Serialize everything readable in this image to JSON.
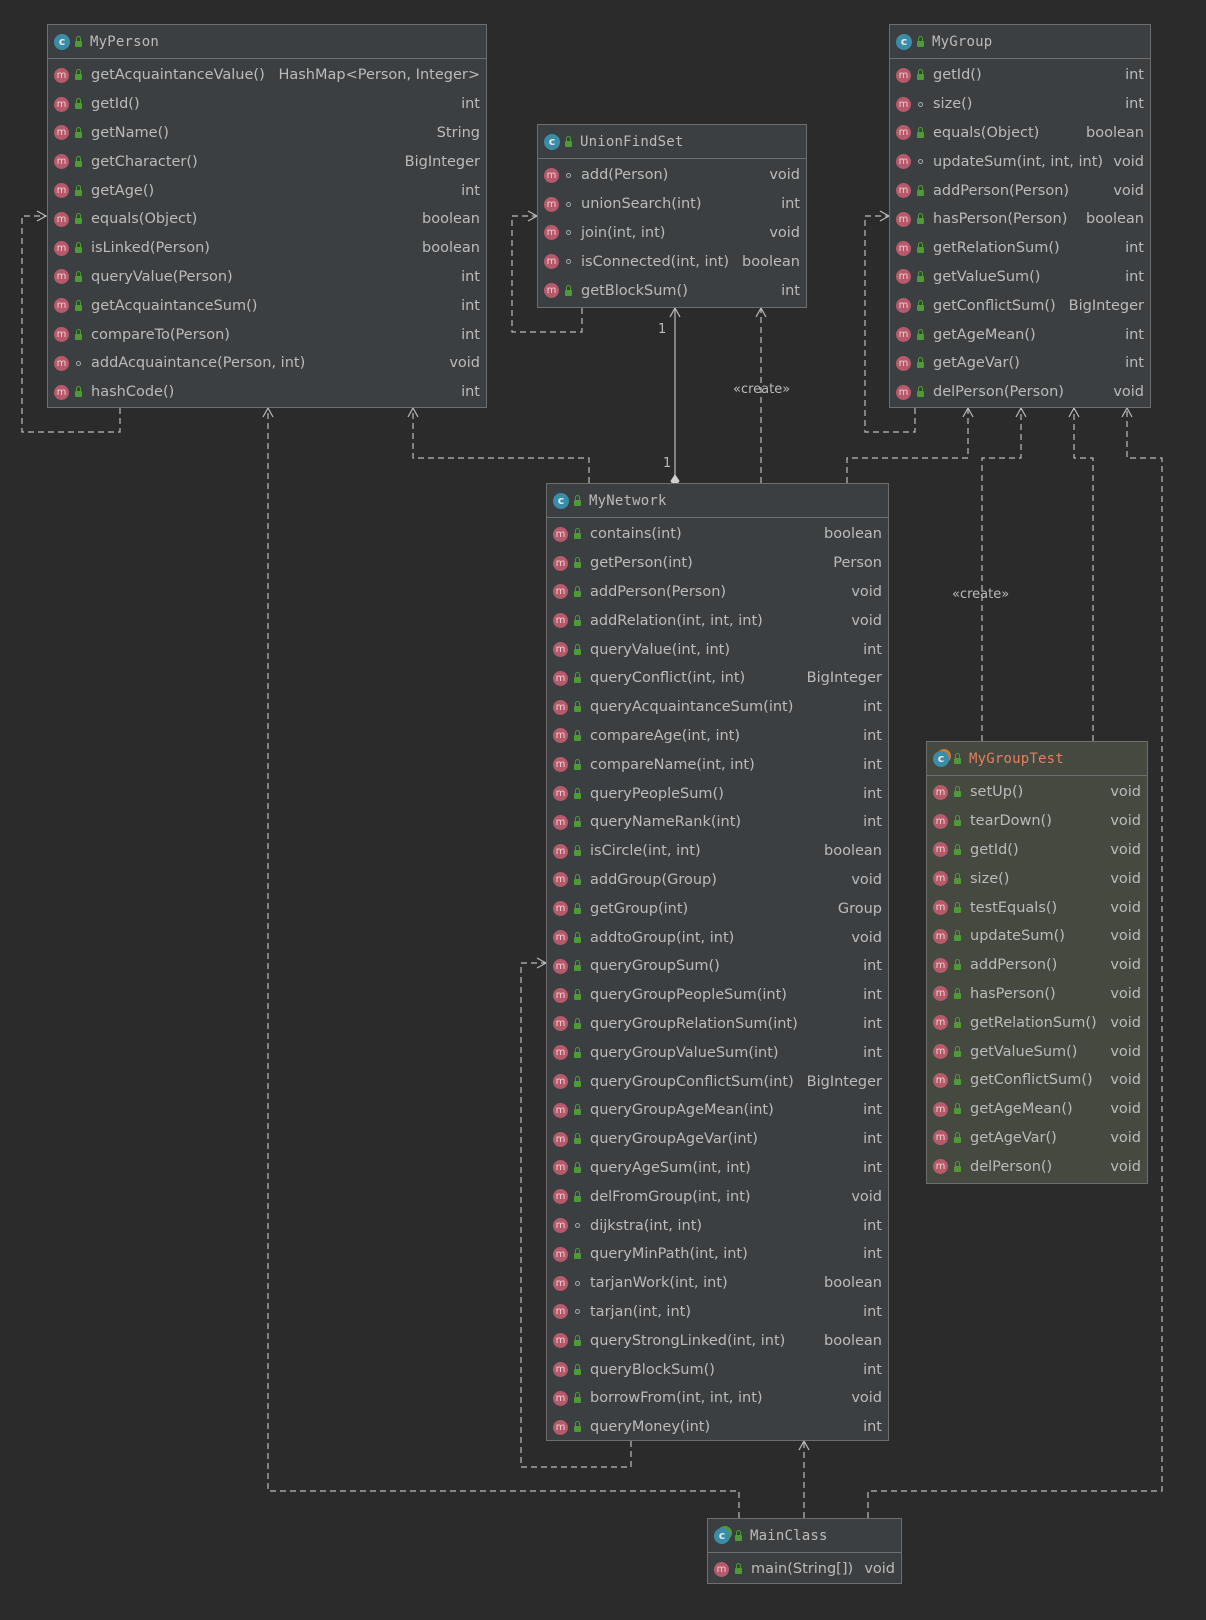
{
  "classes": {
    "myperson": {
      "name": "MyPerson",
      "methods": [
        {
          "name": "getAcquaintanceValue()",
          "type": "HashMap<Person, Integer>",
          "vis": "public"
        },
        {
          "name": "getId()",
          "type": "int",
          "vis": "public"
        },
        {
          "name": "getName()",
          "type": "String",
          "vis": "public"
        },
        {
          "name": "getCharacter()",
          "type": "BigInteger",
          "vis": "public"
        },
        {
          "name": "getAge()",
          "type": "int",
          "vis": "public"
        },
        {
          "name": "equals(Object)",
          "type": "boolean",
          "vis": "public"
        },
        {
          "name": "isLinked(Person)",
          "type": "boolean",
          "vis": "public"
        },
        {
          "name": "queryValue(Person)",
          "type": "int",
          "vis": "public"
        },
        {
          "name": "getAcquaintanceSum()",
          "type": "int",
          "vis": "public"
        },
        {
          "name": "compareTo(Person)",
          "type": "int",
          "vis": "public"
        },
        {
          "name": "addAcquaintance(Person, int)",
          "type": "void",
          "vis": "package"
        },
        {
          "name": "hashCode()",
          "type": "int",
          "vis": "public"
        }
      ]
    },
    "unionfindset": {
      "name": "UnionFindSet",
      "methods": [
        {
          "name": "add(Person)",
          "type": "void",
          "vis": "package"
        },
        {
          "name": "unionSearch(int)",
          "type": "int",
          "vis": "package"
        },
        {
          "name": "join(int, int)",
          "type": "void",
          "vis": "package"
        },
        {
          "name": "isConnected(int, int)",
          "type": "boolean",
          "vis": "package"
        },
        {
          "name": "getBlockSum()",
          "type": "int",
          "vis": "public"
        }
      ]
    },
    "mygroup": {
      "name": "MyGroup",
      "methods": [
        {
          "name": "getId()",
          "type": "int",
          "vis": "public"
        },
        {
          "name": "size()",
          "type": "int",
          "vis": "package"
        },
        {
          "name": "equals(Object)",
          "type": "boolean",
          "vis": "public"
        },
        {
          "name": "updateSum(int, int, int)",
          "type": "void",
          "vis": "package"
        },
        {
          "name": "addPerson(Person)",
          "type": "void",
          "vis": "public"
        },
        {
          "name": "hasPerson(Person)",
          "type": "boolean",
          "vis": "public"
        },
        {
          "name": "getRelationSum()",
          "type": "int",
          "vis": "public"
        },
        {
          "name": "getValueSum()",
          "type": "int",
          "vis": "public"
        },
        {
          "name": "getConflictSum()",
          "type": "BigInteger",
          "vis": "public"
        },
        {
          "name": "getAgeMean()",
          "type": "int",
          "vis": "public"
        },
        {
          "name": "getAgeVar()",
          "type": "int",
          "vis": "public"
        },
        {
          "name": "delPerson(Person)",
          "type": "void",
          "vis": "public"
        }
      ]
    },
    "mynetwork": {
      "name": "MyNetwork",
      "methods": [
        {
          "name": "contains(int)",
          "type": "boolean",
          "vis": "public"
        },
        {
          "name": "getPerson(int)",
          "type": "Person",
          "vis": "public"
        },
        {
          "name": "addPerson(Person)",
          "type": "void",
          "vis": "public"
        },
        {
          "name": "addRelation(int, int, int)",
          "type": "void",
          "vis": "public"
        },
        {
          "name": "queryValue(int, int)",
          "type": "int",
          "vis": "public"
        },
        {
          "name": "queryConflict(int, int)",
          "type": "BigInteger",
          "vis": "public"
        },
        {
          "name": "queryAcquaintanceSum(int)",
          "type": "int",
          "vis": "public"
        },
        {
          "name": "compareAge(int, int)",
          "type": "int",
          "vis": "public"
        },
        {
          "name": "compareName(int, int)",
          "type": "int",
          "vis": "public"
        },
        {
          "name": "queryPeopleSum()",
          "type": "int",
          "vis": "public"
        },
        {
          "name": "queryNameRank(int)",
          "type": "int",
          "vis": "public"
        },
        {
          "name": "isCircle(int, int)",
          "type": "boolean",
          "vis": "public"
        },
        {
          "name": "addGroup(Group)",
          "type": "void",
          "vis": "public"
        },
        {
          "name": "getGroup(int)",
          "type": "Group",
          "vis": "public"
        },
        {
          "name": "addtoGroup(int, int)",
          "type": "void",
          "vis": "public"
        },
        {
          "name": "queryGroupSum()",
          "type": "int",
          "vis": "public"
        },
        {
          "name": "queryGroupPeopleSum(int)",
          "type": "int",
          "vis": "public"
        },
        {
          "name": "queryGroupRelationSum(int)",
          "type": "int",
          "vis": "public"
        },
        {
          "name": "queryGroupValueSum(int)",
          "type": "int",
          "vis": "public"
        },
        {
          "name": "queryGroupConflictSum(int)",
          "type": "BigInteger",
          "vis": "public"
        },
        {
          "name": "queryGroupAgeMean(int)",
          "type": "int",
          "vis": "public"
        },
        {
          "name": "queryGroupAgeVar(int)",
          "type": "int",
          "vis": "public"
        },
        {
          "name": "queryAgeSum(int, int)",
          "type": "int",
          "vis": "public"
        },
        {
          "name": "delFromGroup(int, int)",
          "type": "void",
          "vis": "public"
        },
        {
          "name": "dijkstra(int, int)",
          "type": "int",
          "vis": "package"
        },
        {
          "name": "queryMinPath(int, int)",
          "type": "int",
          "vis": "public"
        },
        {
          "name": "tarjanWork(int, int)",
          "type": "boolean",
          "vis": "package"
        },
        {
          "name": "tarjan(int, int)",
          "type": "int",
          "vis": "package"
        },
        {
          "name": "queryStrongLinked(int, int)",
          "type": "boolean",
          "vis": "public"
        },
        {
          "name": "queryBlockSum()",
          "type": "int",
          "vis": "public"
        },
        {
          "name": "borrowFrom(int, int, int)",
          "type": "void",
          "vis": "public"
        },
        {
          "name": "queryMoney(int)",
          "type": "int",
          "vis": "public"
        }
      ]
    },
    "mygrouptest": {
      "name": "MyGroupTest",
      "methods": [
        {
          "name": "setUp()",
          "type": "void",
          "vis": "public"
        },
        {
          "name": "tearDown()",
          "type": "void",
          "vis": "public"
        },
        {
          "name": "getId()",
          "type": "void",
          "vis": "public"
        },
        {
          "name": "size()",
          "type": "void",
          "vis": "public"
        },
        {
          "name": "testEquals()",
          "type": "void",
          "vis": "public"
        },
        {
          "name": "updateSum()",
          "type": "void",
          "vis": "public"
        },
        {
          "name": "addPerson()",
          "type": "void",
          "vis": "public"
        },
        {
          "name": "hasPerson()",
          "type": "void",
          "vis": "public"
        },
        {
          "name": "getRelationSum()",
          "type": "void",
          "vis": "public"
        },
        {
          "name": "getValueSum()",
          "type": "void",
          "vis": "public"
        },
        {
          "name": "getConflictSum()",
          "type": "void",
          "vis": "public"
        },
        {
          "name": "getAgeMean()",
          "type": "void",
          "vis": "public"
        },
        {
          "name": "getAgeVar()",
          "type": "void",
          "vis": "public"
        },
        {
          "name": "delPerson()",
          "type": "void",
          "vis": "public"
        }
      ]
    },
    "mainclass": {
      "name": "MainClass",
      "methods": [
        {
          "name": "main(String[])",
          "type": "void",
          "vis": "public"
        }
      ]
    }
  },
  "edge_labels": {
    "create_unionfind": "«create»",
    "create_mygroup": "«create»",
    "multiplicity_top": "1",
    "multiplicity_bottom": "1"
  },
  "icons": {
    "class_letter": "c",
    "method_letter": "m"
  },
  "colors": {
    "background": "#2b2b2b",
    "class_fill": "#3c3f41",
    "test_fill": "#45493f",
    "method_icon": "#b65a6b",
    "class_icon": "#3a8da8",
    "public_lock": "#4e9a35",
    "test_title": "#e08060"
  }
}
